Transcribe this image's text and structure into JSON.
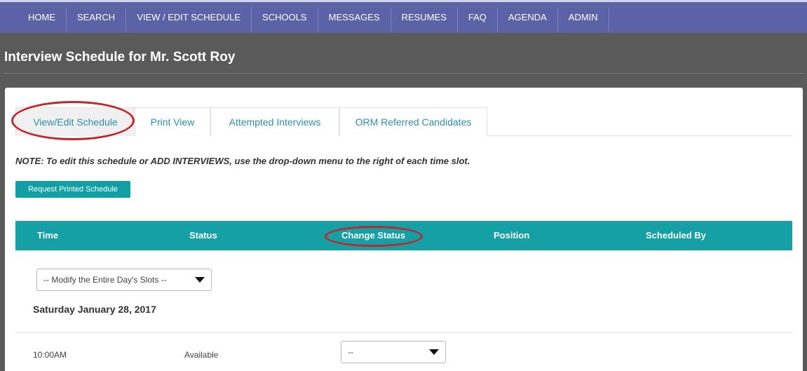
{
  "nav": {
    "items": [
      {
        "label": "HOME"
      },
      {
        "label": "SEARCH"
      },
      {
        "label": "VIEW / EDIT SCHEDULE"
      },
      {
        "label": "SCHOOLS"
      },
      {
        "label": "MESSAGES"
      },
      {
        "label": "RESUMES"
      },
      {
        "label": "FAQ"
      },
      {
        "label": "AGENDA"
      },
      {
        "label": "ADMIN"
      }
    ]
  },
  "page": {
    "title": "Interview Schedule for Mr. Scott Roy"
  },
  "tabs": [
    {
      "label": "View/Edit Schedule",
      "active": true
    },
    {
      "label": "Print View"
    },
    {
      "label": "Attempted Interviews"
    },
    {
      "label": "ORM Referred Candidates"
    }
  ],
  "note": "NOTE: To edit this schedule or ADD INTERVIEWS, use the drop-down menu to the right of each time slot.",
  "request_button": "Request Printed Schedule",
  "table": {
    "headers": [
      "Time",
      "Status",
      "Change Status",
      "Position",
      "Scheduled By"
    ],
    "day_select": "-- Modify the Entire Day's Slots --",
    "day_label": "Saturday January 28, 2017",
    "rows": [
      {
        "time": "10:00AM",
        "status": "Available",
        "change": "--"
      }
    ]
  },
  "colors": {
    "nav_bg": "#5b62a6",
    "page_bg": "#5a5a5a",
    "accent_teal": "#14a0a5",
    "link": "#2e8fa8",
    "highlight_circle": "#c4262e"
  }
}
